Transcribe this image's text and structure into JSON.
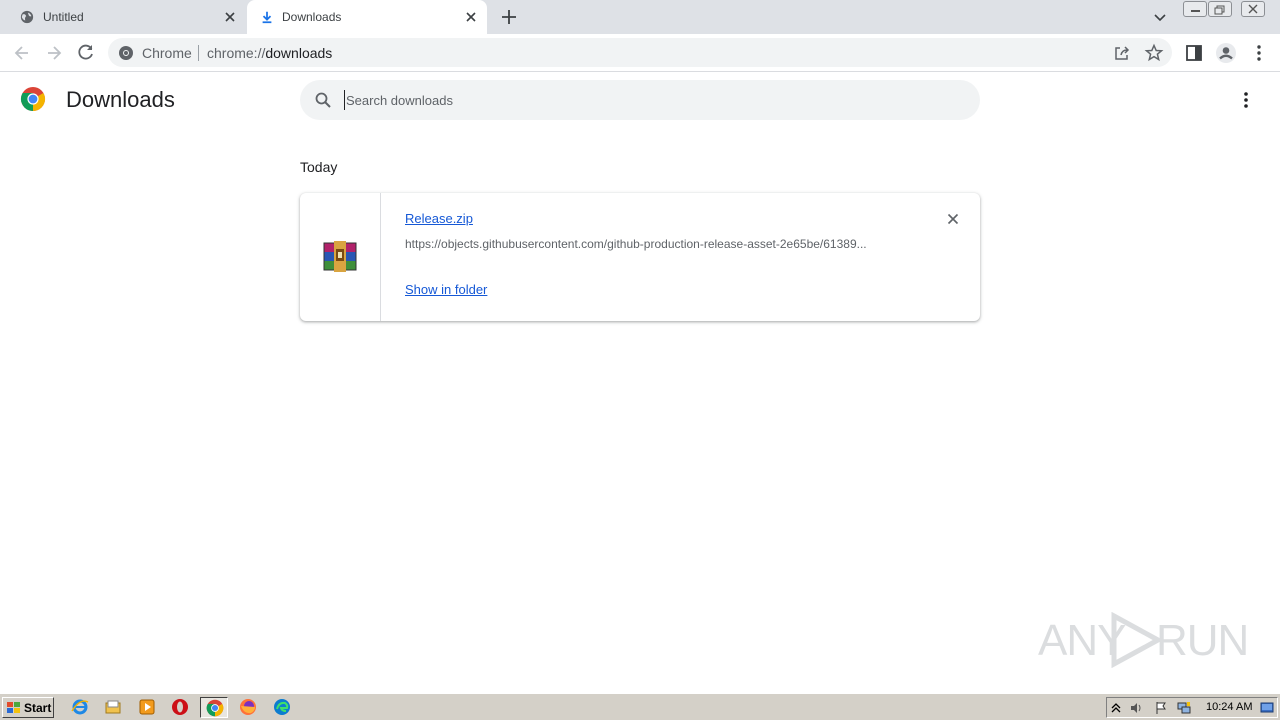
{
  "browser": {
    "tabs": [
      {
        "label": "Untitled",
        "icon": "globe-icon",
        "active": false
      },
      {
        "label": "Downloads",
        "icon": "download-icon",
        "active": true
      }
    ],
    "omnibox": {
      "chip_label": "Chrome",
      "url_scheme": "chrome://",
      "url_path": "downloads"
    }
  },
  "page": {
    "title": "Downloads",
    "search": {
      "placeholder": "Search downloads",
      "value": ""
    },
    "section_label": "Today",
    "downloads": [
      {
        "file_name": "Release.zip",
        "url": "https://objects.githubusercontent.com/github-production-release-asset-2e65be/61389...",
        "action_label": "Show in folder",
        "icon": "winrar-archive-icon"
      }
    ]
  },
  "watermark": {
    "text_left": "ANY",
    "text_right": "RUN"
  },
  "taskbar": {
    "start_label": "Start",
    "clock": "10:24 AM"
  },
  "colors": {
    "link": "#1558d6",
    "tabstrip": "#dee1e6",
    "search_bg": "#f1f3f4",
    "taskbar": "#d4d0c8"
  }
}
